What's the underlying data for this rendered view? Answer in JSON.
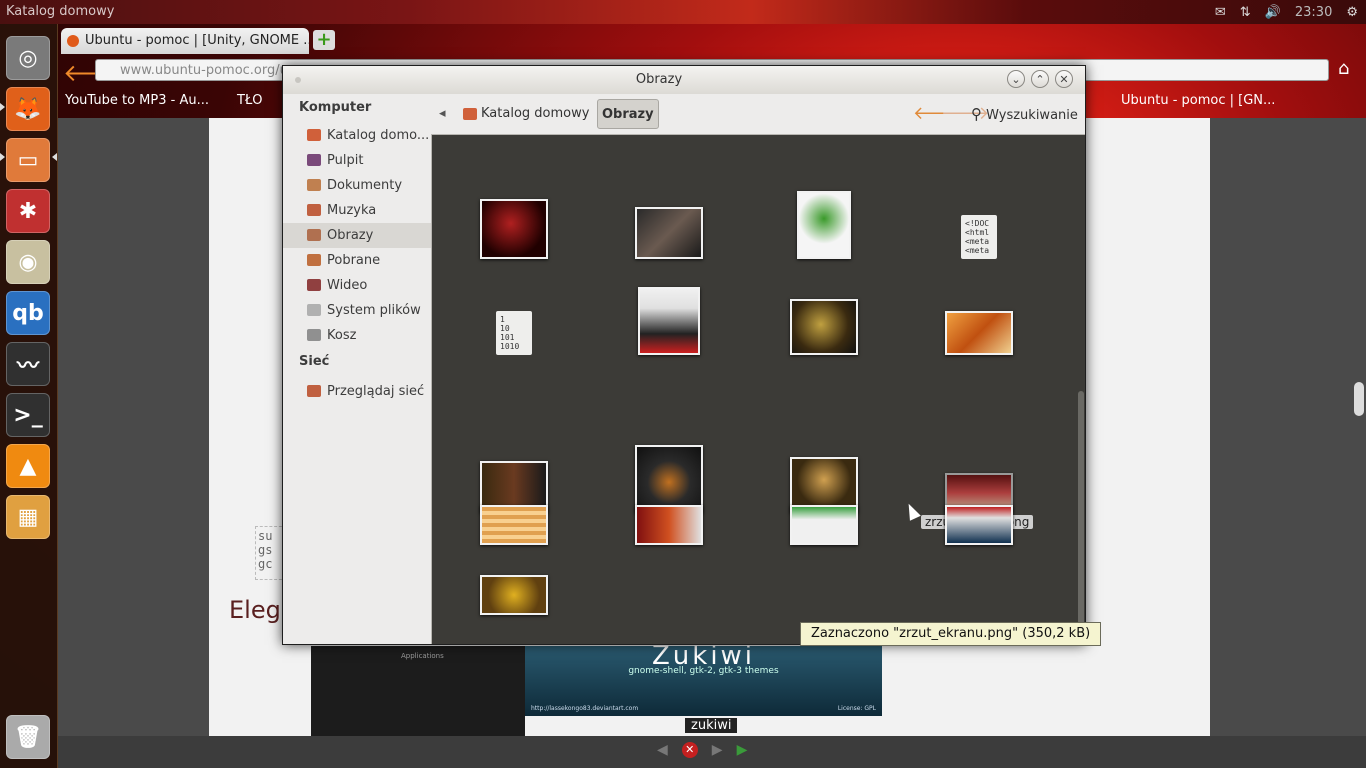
{
  "top_panel": {
    "title": "Katalog domowy",
    "time": "23:30",
    "icons": [
      "mail-icon",
      "network-icon",
      "volume-icon",
      "gear-icon"
    ]
  },
  "launcher": {
    "items": [
      {
        "name": "dash-home",
        "glyph": "◎",
        "color": "#7a7a7a"
      },
      {
        "name": "firefox",
        "glyph": "🦊",
        "color": "#e0601a"
      },
      {
        "name": "files",
        "glyph": "▭",
        "color": "#e07a3a"
      },
      {
        "name": "system-settings",
        "glyph": "✱",
        "color": "#c03030"
      },
      {
        "name": "rhythmbox",
        "glyph": "◉",
        "color": "#c8c0a0"
      },
      {
        "name": "qbittorrent",
        "glyph": "qb",
        "color": "#2a70c0"
      },
      {
        "name": "system-monitor",
        "glyph": "〰",
        "color": "#303030"
      },
      {
        "name": "terminal",
        "glyph": ">_",
        "color": "#303030"
      },
      {
        "name": "vlc",
        "glyph": "▲",
        "color": "#f08a10"
      },
      {
        "name": "workspaces",
        "glyph": "▦",
        "color": "#e0a040"
      },
      {
        "name": "trash",
        "glyph": "🗑",
        "color": "#aaaaaa"
      }
    ]
  },
  "browser": {
    "tab_title": "Ubuntu - pomoc | [Unity, GNOME ...",
    "new_tab": "+",
    "url": "www.ubuntu-pomoc.org/u",
    "bookmarks": [
      "YouTube to MP3 - Au...",
      "TŁO",
      "Ubuntu - pomoc | [GN..."
    ],
    "page_code": [
      "su",
      "gs",
      "gc"
    ],
    "page_heading": "Eleg",
    "zukiwi_title": "Zukiwi",
    "zukiwi_sub": "gnome-shell, gtk-2, gtk-3 themes",
    "zukiwi_url": "http://lassekongo83.deviantart.com",
    "zukiwi_license": "License: GPL",
    "zukiwi_caption": "zukiwi",
    "dark_shot_label": "Applications"
  },
  "nautilus": {
    "title": "Obrazy",
    "sidebar": {
      "computer_heading": "Komputer",
      "network_heading": "Sieć",
      "items": [
        {
          "label": "Katalog domo...",
          "icon": "home-folder-icon",
          "color": "#d0603a",
          "selected": false
        },
        {
          "label": "Pulpit",
          "icon": "desktop-icon",
          "color": "#7a4a7a",
          "selected": false
        },
        {
          "label": "Dokumenty",
          "icon": "documents-icon",
          "color": "#c08050",
          "selected": false
        },
        {
          "label": "Muzyka",
          "icon": "music-icon",
          "color": "#c06040",
          "selected": false
        },
        {
          "label": "Obrazy",
          "icon": "pictures-icon",
          "color": "#b07050",
          "selected": true
        },
        {
          "label": "Pobrane",
          "icon": "downloads-icon",
          "color": "#c07040",
          "selected": false
        },
        {
          "label": "Wideo",
          "icon": "video-icon",
          "color": "#904040",
          "selected": false
        },
        {
          "label": "System plików",
          "icon": "drive-icon",
          "color": "#b0b0b0",
          "selected": false
        },
        {
          "label": "Kosz",
          "icon": "trash-icon",
          "color": "#909090",
          "selected": false
        }
      ],
      "network_items": [
        {
          "label": "Przeglądaj sieć",
          "icon": "network-browse-icon",
          "color": "#c06040"
        }
      ]
    },
    "pathbar": {
      "home": "Katalog domowy",
      "current": "Obrazy",
      "search_label": "Wyszukiwanie"
    },
    "files": [
      {
        "kind": "img",
        "bg": "radial-gradient(circle at 45% 40%,#b02020,#200000 70%)"
      },
      {
        "kind": "img",
        "bg": "linear-gradient(135deg,#2a2a2a,#6a5a50,#1a1a1a)"
      },
      {
        "kind": "img",
        "bg": "radial-gradient(circle at 50% 40%,#3a9a2a,#f5f5f5 55%)"
      },
      {
        "kind": "doc",
        "text": "<!DOC\n<html\n<meta\n<meta"
      },
      {
        "kind": "doc",
        "text": "1\n10\n101\n1010"
      },
      {
        "kind": "img",
        "bg": "linear-gradient(#f0f0f0,#e0e0e0 30%,#222 70%,#cc2020)"
      },
      {
        "kind": "img",
        "bg": "radial-gradient(circle at 45% 45%,#c0a040,#3a2a10 60%,#101010)"
      },
      {
        "kind": "img",
        "bg": "linear-gradient(135deg,#f0a040,#c05010,#f0d090)"
      },
      {
        "kind": "img",
        "bg": "linear-gradient(90deg,#3a2a10,#6a3a20,#1a1a1a)"
      },
      {
        "kind": "img",
        "bg": "radial-gradient(circle at 50% 55%,#c07020,#2a2a2a 45%,#101010)"
      },
      {
        "kind": "img",
        "bg": "radial-gradient(circle at 50% 40%,#d0a050,#3a2a10 60%)"
      },
      {
        "kind": "img",
        "bg": "linear-gradient(#5a0a0a,#c04040,#d0c0a0)",
        "name": "zrzut_ekranu.png",
        "selected": true
      },
      {
        "kind": "img",
        "bg": "repeating-linear-gradient(#e0a050 0 4px,#f8d090 4px 8px)"
      },
      {
        "kind": "img",
        "bg": "linear-gradient(90deg,#801010,#d05020,#e0e0e0)"
      },
      {
        "kind": "img",
        "bg": "linear-gradient(#3aa040,#f0f0f0 35%)"
      },
      {
        "kind": "img",
        "bg": "linear-gradient(#c02020,#e0e0e0 30%,#103050)"
      },
      {
        "kind": "img",
        "bg": "radial-gradient(circle at 50% 50%,#e0b020,#604010 70%)"
      }
    ],
    "status": "Zaznaczono \"zrzut_ekranu.png\" (350,2 kB)"
  }
}
